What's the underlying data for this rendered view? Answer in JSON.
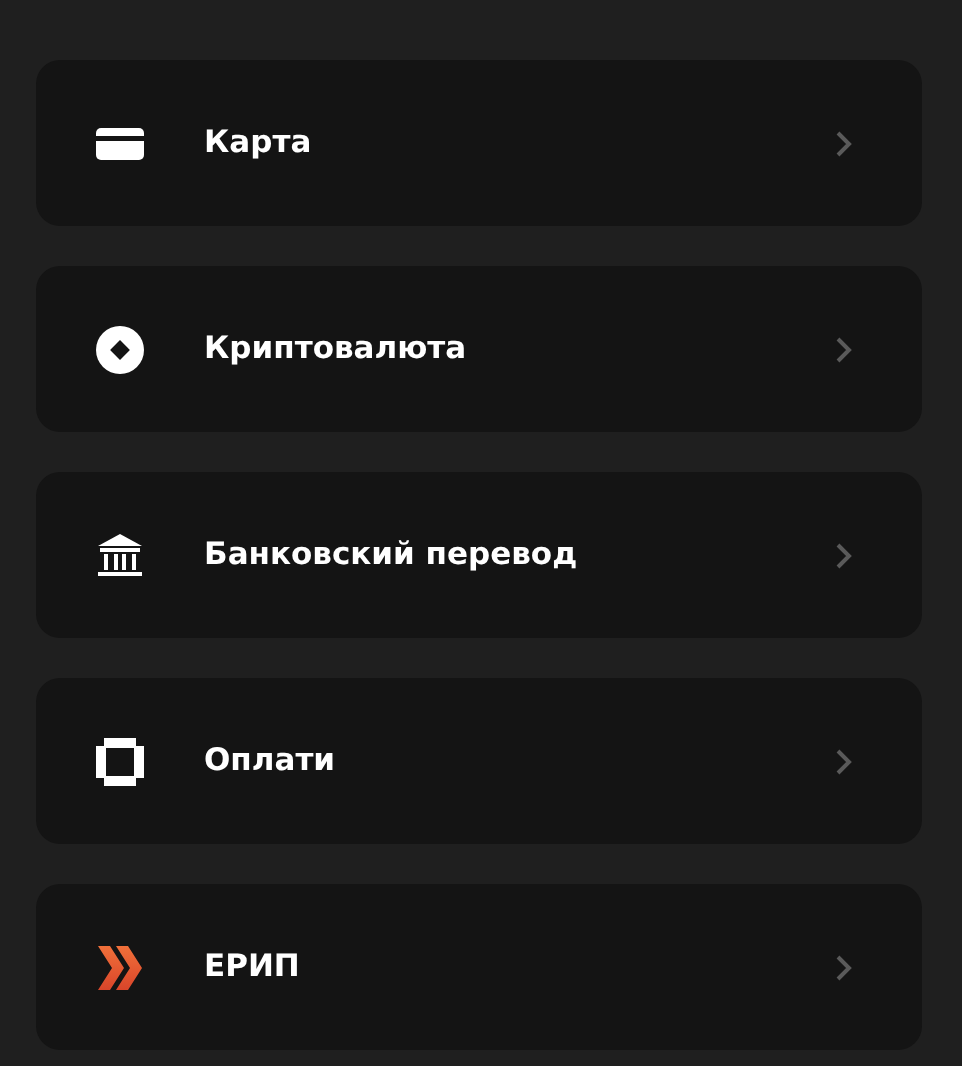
{
  "payment_methods": [
    {
      "kind": "card",
      "label": "Карта"
    },
    {
      "kind": "crypto",
      "label": "Криптовалюта"
    },
    {
      "kind": "bank",
      "label": "Банковский перевод"
    },
    {
      "kind": "oplati",
      "label": "Оплати"
    },
    {
      "kind": "erip",
      "label": "ЕРИП"
    }
  ]
}
